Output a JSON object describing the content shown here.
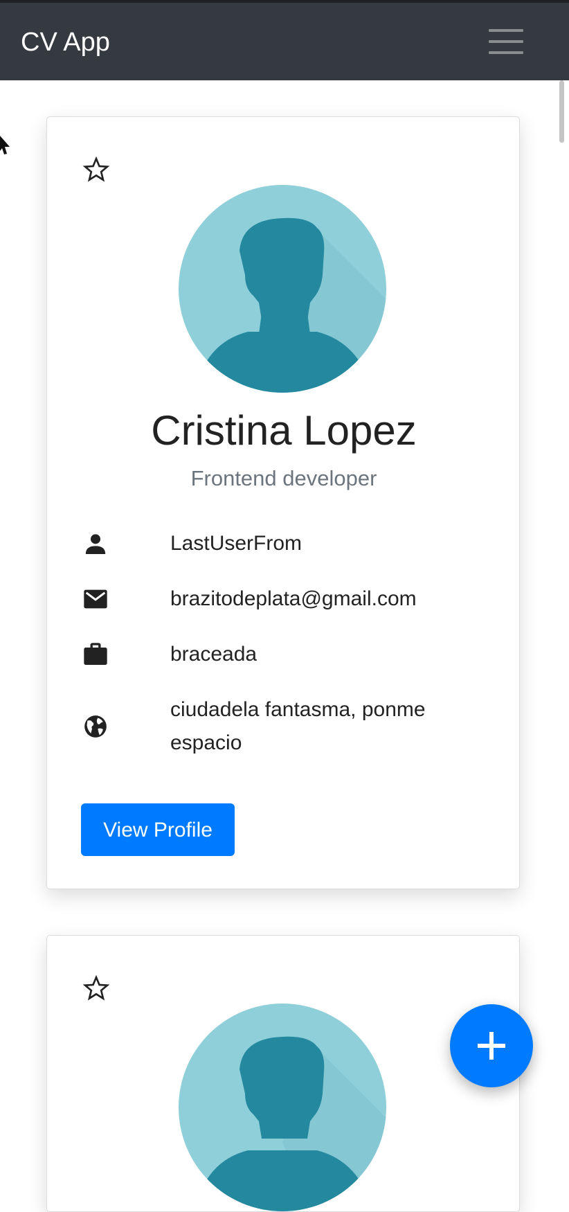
{
  "navbar": {
    "brand": "CV App",
    "menu_icon": "hamburger-menu-icon"
  },
  "cards": [
    {
      "favorite_icon": "star-outline-icon",
      "avatar": "person-avatar",
      "name": "Cristina Lopez",
      "role": "Frontend developer",
      "username": "LastUserFrom",
      "email": "brazitodeplata@gmail.com",
      "company": "braceada",
      "location": "ciudadela fantasma, ponme espacio",
      "button_label": "View Profile"
    },
    {
      "favorite_icon": "star-outline-icon",
      "avatar": "person-avatar"
    }
  ],
  "fab": {
    "icon": "plus-icon"
  },
  "colors": {
    "navbar_bg": "#343a40",
    "primary": "#007bff",
    "avatar_light": "#8ecfda",
    "avatar_dark": "#24889f",
    "muted_text": "#6c757d"
  }
}
